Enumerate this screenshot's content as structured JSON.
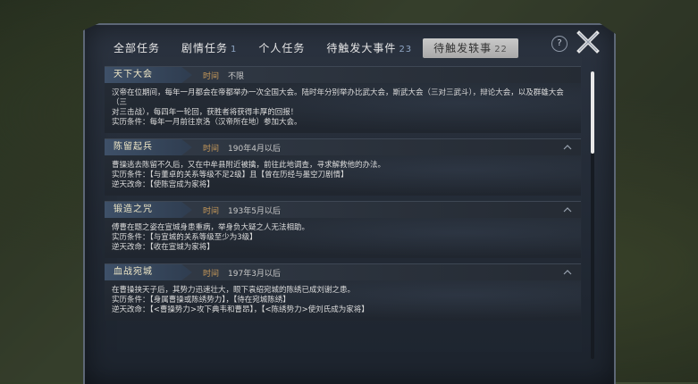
{
  "tabs": [
    {
      "label": "全部任务",
      "count": ""
    },
    {
      "label": "剧情任务",
      "count": "1"
    },
    {
      "label": "个人任务",
      "count": ""
    },
    {
      "label": "待触发大事件",
      "count": "23"
    },
    {
      "label": "待触发轶事",
      "count": "22"
    }
  ],
  "help_symbol": "?",
  "time_label": "时间",
  "cards": [
    {
      "title": "天下大会",
      "time": "不限",
      "lines": [
        "汉帝在位期间，每年一月都会在帝都举办一次全国大会。陆时年分别举办比武大会，斯武大会（三对三武斗），辩论大会，以及群雄大会（三",
        "对三击战），每四年一轮回，获胜者将获得丰厚的回报！",
        "实历条件：每年一月前往京洛（汉帝所在地）参加大会。"
      ]
    },
    {
      "title": "陈留起兵",
      "time": "190年4月以后",
      "lines": [
        "曹操逃去陈留不久后，又在中牟县附近被擒，前往此地调查，寻求解救他的办法。",
        "实历条件：【与董卓的关系等级不足2级】且【曾在历经与墨空刀剧情】",
        "逆天改命：【使陈宫成为家将】"
      ]
    },
    {
      "title": "锻造之咒",
      "time": "193年5月以后",
      "lines": [
        "傅曹在题之姿在宣城身患重病，举身负大疑之人无法相助。",
        "实历条件：【与宣城的关系等级至少为3级】",
        "逆天改命：【收在宣城为家将】"
      ]
    },
    {
      "title": "血战宛城",
      "time": "197年3月以后",
      "lines": [
        "在曹操挟天子后，其势力迅速壮大，眼下袁绍宛城的陈绣已成刘谢之患。",
        "实历条件：【身属曹操或陈绣势力】，【待在宛城陈绣】",
        "逆天改命：【<曹操势力>攻下典韦和曹昂】，【<陈绣势力>使刘氏成为家将】"
      ]
    }
  ]
}
